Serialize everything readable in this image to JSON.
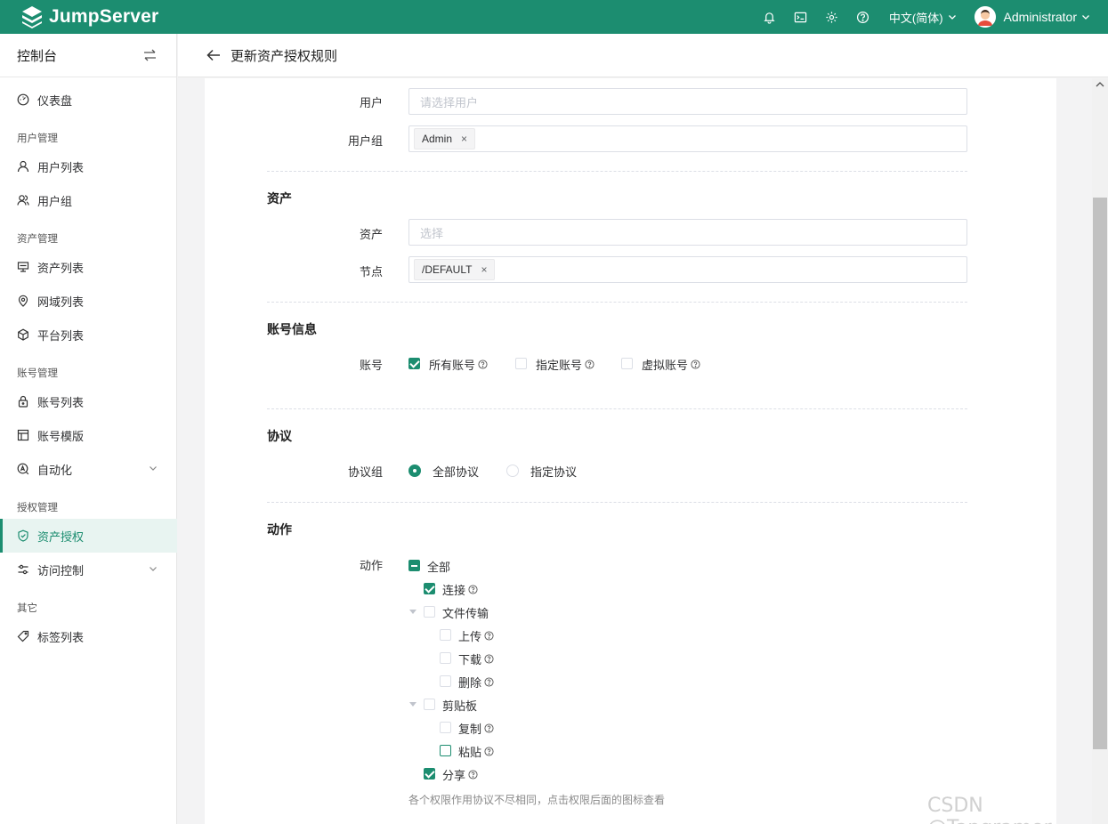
{
  "brand": {
    "name": "JumpServer"
  },
  "topbar": {
    "icons": [
      "bell-icon",
      "terminal-icon",
      "gear-icon",
      "help-icon"
    ],
    "language": "中文(简体)",
    "user": "Administrator"
  },
  "sidebar": {
    "title": "控制台",
    "items": {
      "dashboard": "仪表盘",
      "user_mgmt": "用户管理",
      "user_list": "用户列表",
      "user_group": "用户组",
      "asset_mgmt": "资产管理",
      "asset_list": "资产列表",
      "zone_list": "网域列表",
      "platform_list": "平台列表",
      "account_mgmt": "账号管理",
      "account_list": "账号列表",
      "account_template": "账号模版",
      "automation": "自动化",
      "perm_mgmt": "授权管理",
      "asset_perm": "资产授权",
      "access_control": "访问控制",
      "other": "其它",
      "label_list": "标签列表"
    }
  },
  "page": {
    "title": "更新资产授权规则"
  },
  "form": {
    "users": {
      "label": "用户",
      "placeholder": "请选择用户"
    },
    "user_groups": {
      "label": "用户组",
      "tags": [
        "Admin"
      ]
    },
    "asset_section": "资产",
    "assets": {
      "label": "资产",
      "placeholder": "选择"
    },
    "nodes": {
      "label": "节点",
      "tags": [
        "/DEFAULT"
      ]
    },
    "account_section": "账号信息",
    "accounts": {
      "label": "账号",
      "options": [
        {
          "label": "所有账号",
          "checked": true
        },
        {
          "label": "指定账号",
          "checked": false
        },
        {
          "label": "虚拟账号",
          "checked": false
        }
      ]
    },
    "protocol_section": "协议",
    "protocol_group": {
      "label": "协议组",
      "options": [
        {
          "label": "全部协议",
          "selected": true
        },
        {
          "label": "指定协议",
          "selected": false
        }
      ]
    },
    "action_section": "动作",
    "actions": {
      "label": "动作",
      "all": "全部",
      "connect": "连接",
      "file_transfer": "文件传输",
      "upload": "上传",
      "download": "下载",
      "delete": "删除",
      "clipboard": "剪贴板",
      "copy": "复制",
      "paste": "粘贴",
      "share": "分享",
      "hint": "各个权限作用协议不尽相同，点击权限后面的图标查看"
    }
  },
  "watermark": "CSDN @Tangramor",
  "colors": {
    "brand": "#1c8d70"
  }
}
